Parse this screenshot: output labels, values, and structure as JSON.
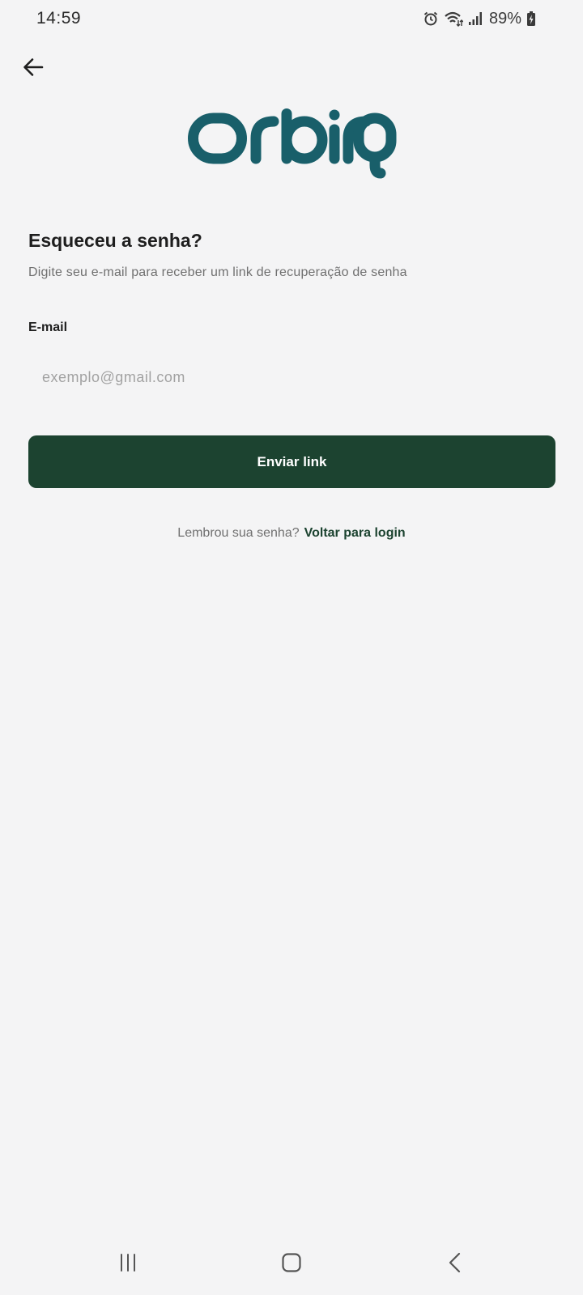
{
  "status_bar": {
    "time": "14:59",
    "battery_percent": "89%",
    "icons": [
      "alarm-icon",
      "wifi-icon",
      "signal-icon",
      "battery-charging-icon"
    ]
  },
  "header": {
    "back_icon": "arrow-left-icon"
  },
  "logo": {
    "text": "Orbirq",
    "color": "#195f6a"
  },
  "form": {
    "title": "Esqueceu a senha?",
    "subtitle": "Digite seu e-mail para receber um link de recuperação de senha",
    "email_label": "E-mail",
    "email_placeholder": "exemplo@gmail.com",
    "email_value": "",
    "submit_label": "Enviar link"
  },
  "footer": {
    "question": "Lembrou sua senha?",
    "link_label": "Voltar para login"
  },
  "colors": {
    "background": "#f4f4f5",
    "primary": "#1c4330",
    "logo": "#195f6a"
  },
  "nav_bar": {
    "icons": [
      "recent-apps-icon",
      "home-icon",
      "back-nav-icon"
    ]
  }
}
